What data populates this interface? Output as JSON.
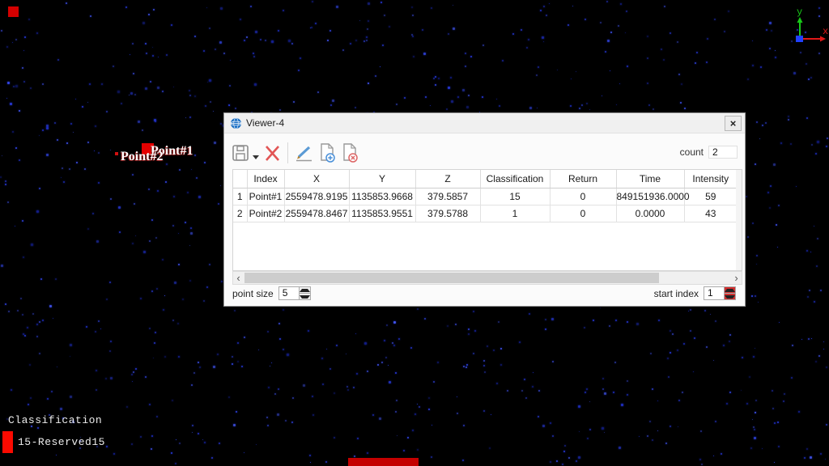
{
  "window": {
    "title": "Viewer-4",
    "close_glyph": "×",
    "toolbar": {
      "count_label": "count",
      "count_value": "2"
    },
    "table": {
      "columns": [
        "Index",
        "X",
        "Y",
        "Z",
        "Classification",
        "Return",
        "Time",
        "Intensity"
      ],
      "rows": [
        [
          "1",
          "Point#1",
          "2559478.9195",
          "1135853.9668",
          "379.5857",
          "15",
          "0",
          "849151936.0000",
          "59"
        ],
        [
          "2",
          "Point#2",
          "2559478.8467",
          "1135853.9551",
          "379.5788",
          "1",
          "0",
          "0.0000",
          "43"
        ]
      ]
    },
    "scrollbar": {
      "left_glyph": "‹",
      "right_glyph": "›"
    },
    "footer": {
      "point_size_label": "point size",
      "point_size_value": "5",
      "start_index_label": "start index",
      "start_index_value": "1"
    }
  },
  "viewport": {
    "point_labels": [
      {
        "text": "Point#1"
      },
      {
        "text": "Point#2"
      }
    ],
    "legend": {
      "title": "Classification",
      "entries": [
        {
          "label": "15-Reserved15",
          "color": "#fb0a00"
        }
      ]
    },
    "axis": {
      "x_label": "x",
      "y_label": "y",
      "x_color": "#e01818",
      "y_color": "#18c818",
      "origin_color": "#2040ff"
    }
  },
  "colors": {
    "background": "#000000",
    "point_dot": "#2a3ae0",
    "marker_red": "#e40000",
    "dialog_bg": "#fbfbfb"
  }
}
